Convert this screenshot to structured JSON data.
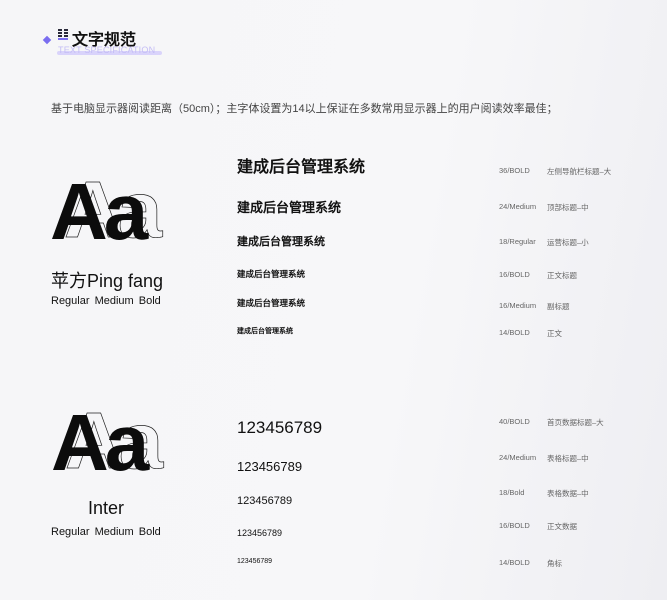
{
  "header": {
    "title": "文字规范",
    "subtitle": "TEXT SPECIFICATION",
    "description": "基于电脑显示器阅读距离（50cm）；主字体设置为14以上保证在多数常用显示器上的用户阅读效率最佳；"
  },
  "fonts": [
    {
      "sample": "Aa",
      "name": "苹方Ping fang",
      "weights": "Regular   Medium   Bold",
      "specs": [
        {
          "text": "建成后台管理系统",
          "size": "36/BOLD",
          "usage": "左侧导航栏标题–大"
        },
        {
          "text": "建成后台管理系统",
          "size": "24/Medium",
          "usage": "顶部标题–中"
        },
        {
          "text": "建成后台管理系统",
          "size": "18/Regular",
          "usage": "运营标题–小"
        },
        {
          "text": "建成后台管理系统",
          "size": "16/BOLD",
          "usage": "正文标题"
        },
        {
          "text": "建成后台管理系统",
          "size": "16/Medium",
          "usage": "副标题"
        },
        {
          "text": "建成后台管理系统",
          "size": "14/BOLD",
          "usage": "正文"
        }
      ]
    },
    {
      "sample": "Aa",
      "name": "Inter",
      "weights": "Regular   Medium   Bold",
      "specs": [
        {
          "text": "123456789",
          "size": "40/BOLD",
          "usage": "首页数据标题–大"
        },
        {
          "text": "123456789",
          "size": "24/Medium",
          "usage": "表格标题–中"
        },
        {
          "text": "123456789",
          "size": "18/Bold",
          "usage": "表格数据–中"
        },
        {
          "text": "123456789",
          "size": "16/BOLD",
          "usage": "正文数据"
        },
        {
          "text": "123456789",
          "size": "14/BOLD",
          "usage": "角标"
        }
      ]
    }
  ],
  "colors": {
    "accent": "#7a6df0",
    "accent_light": "#d6cffb"
  }
}
